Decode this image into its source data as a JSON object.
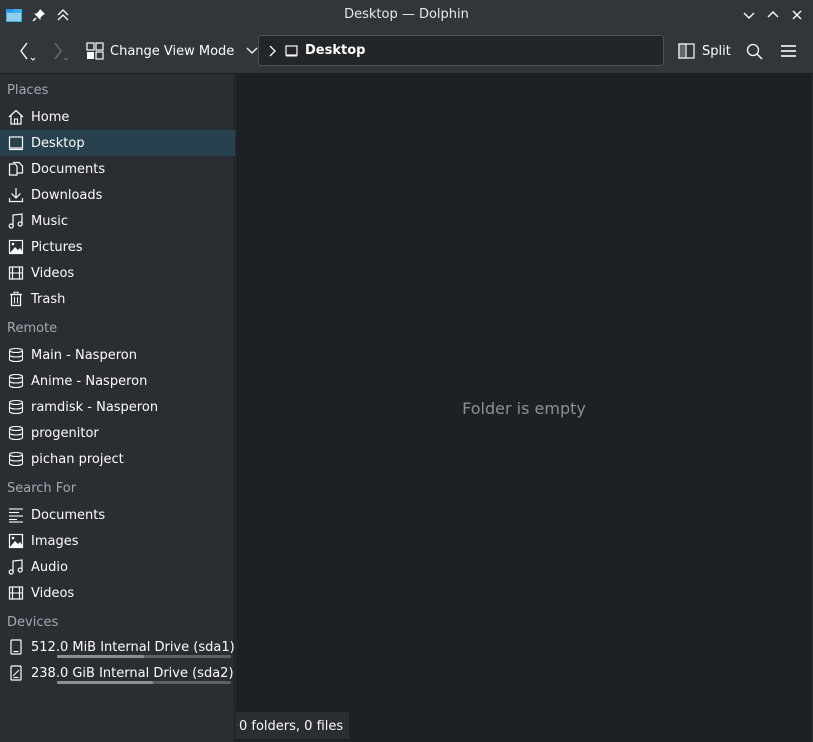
{
  "window": {
    "title": "Desktop — Dolphin"
  },
  "toolbar": {
    "change_view_label": "Change View Mode",
    "split_label": "Split"
  },
  "breadcrumb": {
    "current": "Desktop"
  },
  "sidebar": {
    "places_header": "Places",
    "places": [
      {
        "label": "Home",
        "icon": "home-icon"
      },
      {
        "label": "Desktop",
        "icon": "desktop-icon",
        "selected": true
      },
      {
        "label": "Documents",
        "icon": "documents-icon"
      },
      {
        "label": "Downloads",
        "icon": "downloads-icon"
      },
      {
        "label": "Music",
        "icon": "music-icon"
      },
      {
        "label": "Pictures",
        "icon": "pictures-icon"
      },
      {
        "label": "Videos",
        "icon": "videos-icon"
      },
      {
        "label": "Trash",
        "icon": "trash-icon"
      }
    ],
    "remote_header": "Remote",
    "remote": [
      {
        "label": "Main - Nasperon",
        "icon": "network-drive-icon"
      },
      {
        "label": "Anime - Nasperon",
        "icon": "network-drive-icon"
      },
      {
        "label": "ramdisk - Nasperon",
        "icon": "network-drive-icon"
      },
      {
        "label": "progenitor",
        "icon": "network-drive-icon"
      },
      {
        "label": "pichan project",
        "icon": "network-drive-icon"
      }
    ],
    "search_header": "Search For",
    "search": [
      {
        "label": "Documents",
        "icon": "text-lines-icon"
      },
      {
        "label": "Images",
        "icon": "pictures-icon"
      },
      {
        "label": "Audio",
        "icon": "music-icon"
      },
      {
        "label": "Videos",
        "icon": "videos-icon"
      }
    ],
    "devices_header": "Devices",
    "devices": [
      {
        "label": "512.0 MiB Internal Drive (sda1)",
        "icon": "drive-icon",
        "usage": 0.5
      },
      {
        "label": "238.0 GiB Internal Drive (sda2)",
        "icon": "drive-icon",
        "usage": 0.55
      }
    ]
  },
  "main": {
    "empty_message": "Folder is empty"
  },
  "status": {
    "text": "0 folders, 0 files"
  },
  "colors": {
    "selection": "#28414f",
    "background": "#1e2124",
    "panel": "#31363b"
  }
}
